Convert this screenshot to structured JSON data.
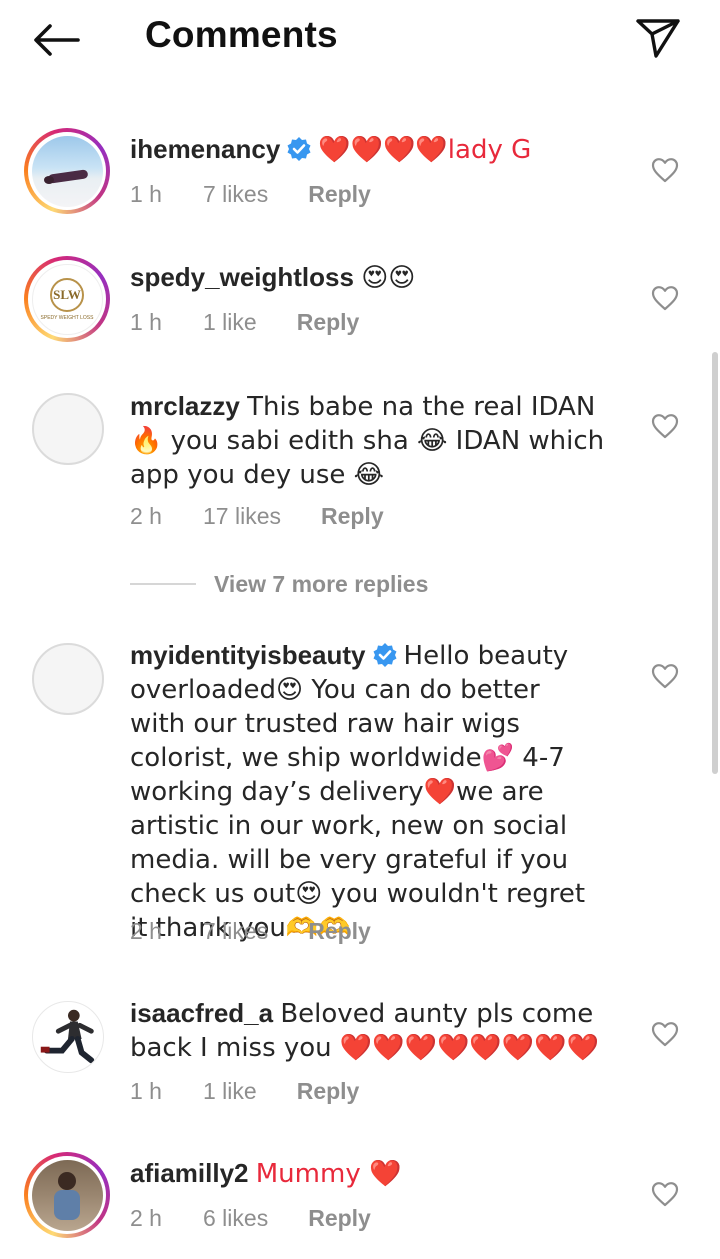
{
  "header": {
    "title": "Comments"
  },
  "comments": [
    {
      "username": "ihemenancy",
      "verified": true,
      "text": "❤️❤️❤️❤️lady G",
      "time": "1 h",
      "likes": "7 likes",
      "reply": "Reply"
    },
    {
      "username": "spedy_weightloss",
      "verified": false,
      "text": "😍😍",
      "time": "1 h",
      "likes": "1 like",
      "reply": "Reply"
    },
    {
      "username": "mrclazzy",
      "verified": false,
      "text": "This babe na the real IDAN 🔥 you sabi edith sha 😂 IDAN which app you dey use 😂",
      "time": "2 h",
      "likes": "17 likes",
      "reply": "Reply"
    },
    {
      "username": "myidentityisbeauty",
      "verified": true,
      "text": "Hello beauty overloaded😍 You can do better with our trusted raw hair wigs colorist, we ship worldwide💕 4-7 working day’s delivery❤️we are artistic in our work, new on social media. will be very grateful if you check us out😍 you wouldn't regret it thank you🫶🫶",
      "time": "2 h",
      "likes": "7 likes",
      "reply": "Reply"
    },
    {
      "username": "isaacfred_a",
      "verified": false,
      "text": "Beloved aunty pls come back I miss you ❤️❤️❤️❤️❤️❤️❤️❤️",
      "time": "1 h",
      "likes": "1 like",
      "reply": "Reply"
    },
    {
      "username": "afiamilly2",
      "verified": false,
      "text": "Mummy ❤️",
      "time": "2 h",
      "likes": "6 likes",
      "reply": "Reply"
    }
  ],
  "view_more": "View 7 more replies",
  "avatar_logo_text": "SLW",
  "avatar_logo_caption": "SPEDY WEIGHT LOSS",
  "colors": {
    "text": "#262626",
    "meta": "#8e8e8e",
    "verified": "#3897f0",
    "heart": "#e8293b"
  },
  "icons": [
    "back-arrow-icon",
    "send-icon",
    "verified-icon",
    "heart-outline-icon"
  ]
}
